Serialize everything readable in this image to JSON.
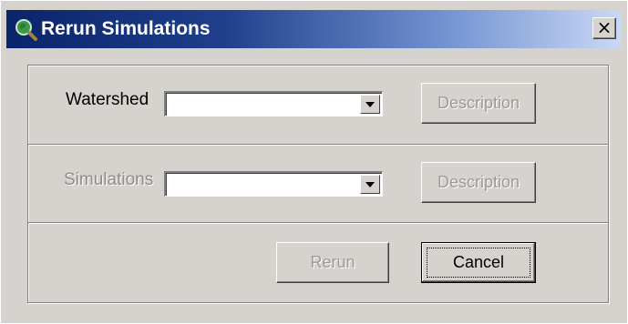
{
  "window": {
    "title": "Rerun Simulations",
    "close_label": "×"
  },
  "watershed": {
    "label": "Watershed",
    "value": "",
    "description_label": "Description"
  },
  "simulations": {
    "label": "Simulations",
    "value": "",
    "description_label": "Description"
  },
  "actions": {
    "rerun_label": "Rerun",
    "cancel_label": "Cancel"
  },
  "icons": {
    "title_icon": "magnifier-globe-icon",
    "close_icon": "close-icon",
    "dropdown_icon": "chevron-down-icon"
  }
}
